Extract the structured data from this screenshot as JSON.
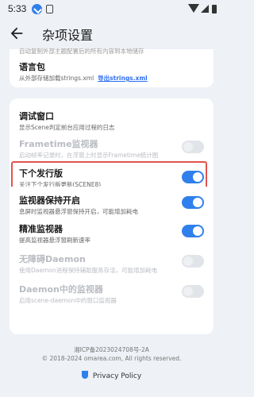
{
  "status_bar": {
    "time": "5:33"
  },
  "app_bar": {
    "title": "杂项设置"
  },
  "card1": {
    "cut_text": "自动复制外部主题配置后的所有内容到本地储存",
    "language": {
      "title": "语言包",
      "desc": "从外部存储加载strings.xml",
      "export_link": "导出strings.xml"
    }
  },
  "card2": {
    "items": [
      {
        "title": "调试窗口",
        "desc": "显示Scene判定前台应用过程的日志",
        "has_switch": false
      },
      {
        "title": "Frametime监视器",
        "desc": "启动帧率记录时，在浮窗上时显示Frametime统计图",
        "enabled": false,
        "checked": false
      },
      {
        "title": "下个发行版",
        "desc": "关注下个发行版更新(SCENE8)",
        "enabled": true,
        "checked": true
      }
    ]
  },
  "card3": {
    "items": [
      {
        "title": "监视器保持开启",
        "desc": "息屏时监视器悬浮窗保持开启，可能增加耗电",
        "enabled": true,
        "checked": true
      },
      {
        "title": "精准监视器",
        "desc": "提高监视器悬浮窗刷新速率",
        "enabled": true,
        "checked": true
      },
      {
        "title": "无障碍Daemon",
        "desc": "使用Daemon进程保持辅助服务存活，可能增加耗电",
        "enabled": false,
        "checked": false
      },
      {
        "title": "Daemon中的监视器",
        "desc": "启用scene-daemon中的窗口监视器",
        "enabled": false,
        "checked": false
      }
    ]
  },
  "footer": {
    "icp": "湘ICP备2023024708号-2A",
    "copyright": "© 2018-2024 omarea.com, All rights reserved.",
    "privacy": "Privacy Policy"
  },
  "colors": {
    "accent": "#2f80ed",
    "highlight": "#e0554f",
    "background": "#eef1f6"
  }
}
